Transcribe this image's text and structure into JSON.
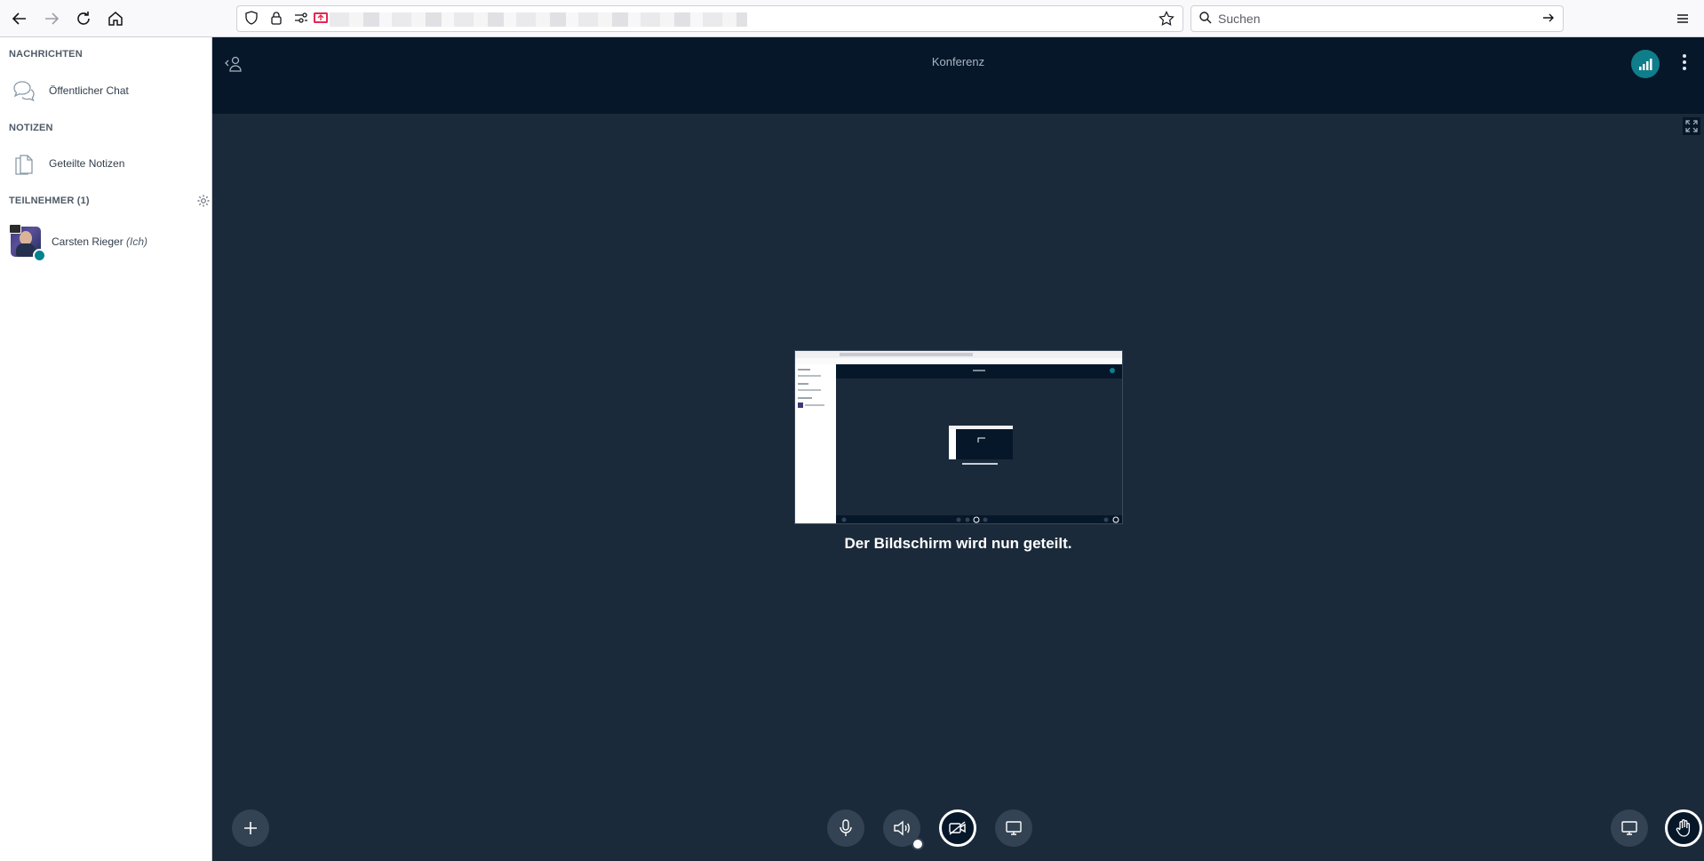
{
  "browser": {
    "search_placeholder": "Suchen"
  },
  "sidebar": {
    "messages_title": "NACHRICHTEN",
    "public_chat_label": "Öffentlicher Chat",
    "notes_title": "NOTIZEN",
    "shared_notes_label": "Geteilte Notizen",
    "participants_title": "TEILNEHMER (1)",
    "user": {
      "name": "Carsten Rieger",
      "self_tag": "(Ich)"
    }
  },
  "main": {
    "conference_title": "Konferenz",
    "screenshare_caption": "Der Bildschirm wird nun geteilt."
  },
  "colors": {
    "topbar": "#06172a",
    "stage": "#1b2a3a",
    "accent": "#0f7e8a"
  }
}
